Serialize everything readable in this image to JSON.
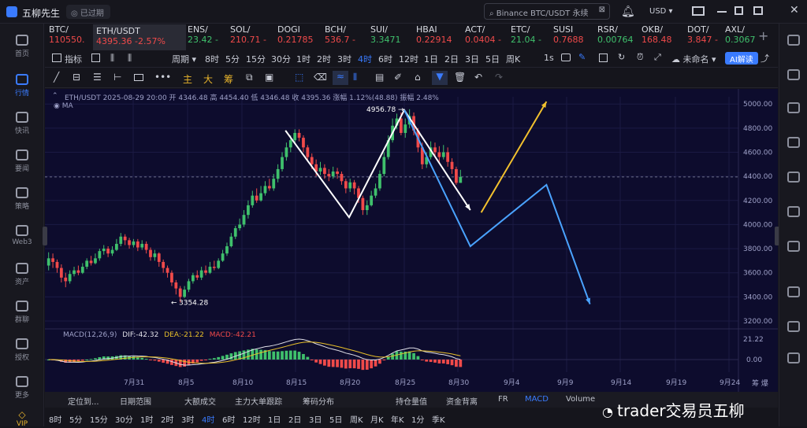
{
  "app": {
    "title": "五柳先生",
    "status": "已过期",
    "search_placeholder": "Binance BTC/USDT 永续",
    "currency": "USD"
  },
  "tickers": [
    {
      "name": "BTC/",
      "price": "110550.",
      "dir": "dn"
    },
    {
      "name": "ETH/USDT",
      "price": "4395.36 -2.57%",
      "dir": "dn"
    },
    {
      "name": "ENS/",
      "price": "23.42 -",
      "dir": "up"
    },
    {
      "name": "SOL/",
      "price": "210.71 -",
      "dir": "dn"
    },
    {
      "name": "DOGI",
      "price": "0.21785",
      "dir": "dn"
    },
    {
      "name": "BCH/",
      "price": "536.7 -",
      "dir": "dn"
    },
    {
      "name": "SUI/",
      "price": "3.3471",
      "dir": "up"
    },
    {
      "name": "HBAI",
      "price": "0.22914",
      "dir": "dn"
    },
    {
      "name": "ACT/",
      "price": "0.0404 -",
      "dir": "dn"
    },
    {
      "name": "ETC/",
      "price": "21.04 -",
      "dir": "up"
    },
    {
      "name": "SUSI",
      "price": "0.7688",
      "dir": "dn"
    },
    {
      "name": "RSR/",
      "price": "0.00764",
      "dir": "up"
    },
    {
      "name": "OKB/",
      "price": "168.48",
      "dir": "dn"
    },
    {
      "name": "DOT/",
      "price": "3.847 -",
      "dir": "dn"
    },
    {
      "name": "AXL/",
      "price": "0.3067",
      "dir": "up"
    }
  ],
  "nav": [
    "首页",
    "行情",
    "快讯",
    "要闻",
    "策略",
    "Web3",
    "资产",
    "群聊",
    "授权",
    "更多",
    "VIP"
  ],
  "toolbar": {
    "indicators": "指标",
    "period": "周期",
    "intervals": [
      "8时",
      "5分",
      "15分",
      "30分",
      "1时",
      "2时",
      "3时",
      "4时",
      "6时",
      "12时",
      "1日",
      "2日",
      "3日",
      "5日",
      "周K"
    ],
    "selected_interval": "4时",
    "right_interval": "1s",
    "layout_name": "未命名",
    "ai": "AI解读"
  },
  "drawing": {
    "main": "主",
    "big": "大",
    "chip": "筹"
  },
  "chart": {
    "legend": "ETH/USDT  2025-08-29 20:00  开 4346.48  高 4454.40  低 4346.48  收 4395.36  涨幅 1.12%(48.88)  振幅 2.48%",
    "ma_label": "MA",
    "macd_label": "MACD(12,26,9)",
    "dif": "DIF:-42.32",
    "dea": "DEA:-21.22",
    "macd": "MACD:-42.21",
    "high_label": "4956.78",
    "low_label": "3354.28",
    "y_ticks": [
      "5000.00",
      "4800.00",
      "4600.00",
      "4400.00",
      "4200.00",
      "4000.00",
      "3800.00",
      "3600.00",
      "3400.00",
      "3200.00"
    ],
    "macd_ticks": [
      "21.22",
      "0.00"
    ],
    "x_ticks": [
      "7月31",
      "8月5",
      "8月10",
      "8月15",
      "8月20",
      "8月25",
      "8月30",
      "9月4",
      "9月9",
      "9月14",
      "9月19",
      "9月24"
    ],
    "corner": "筹 爆"
  },
  "chart_data": {
    "type": "candlestick",
    "symbol": "ETH/USDT",
    "interval": "4h",
    "ylim": [
      3200,
      5060
    ],
    "grid": true,
    "candles": [
      [
        3660,
        3720,
        3770,
        3620
      ],
      [
        3720,
        3690,
        3760,
        3640
      ],
      [
        3690,
        3640,
        3710,
        3600
      ],
      [
        3640,
        3560,
        3670,
        3520
      ],
      [
        3560,
        3530,
        3600,
        3480
      ],
      [
        3530,
        3590,
        3620,
        3510
      ],
      [
        3590,
        3620,
        3650,
        3570
      ],
      [
        3620,
        3600,
        3660,
        3580
      ],
      [
        3600,
        3650,
        3680,
        3590
      ],
      [
        3650,
        3700,
        3720,
        3630
      ],
      [
        3700,
        3680,
        3740,
        3660
      ],
      [
        3680,
        3720,
        3760,
        3670
      ],
      [
        3720,
        3780,
        3800,
        3700
      ],
      [
        3780,
        3800,
        3830,
        3750
      ],
      [
        3800,
        3760,
        3820,
        3730
      ],
      [
        3760,
        3790,
        3820,
        3740
      ],
      [
        3790,
        3840,
        3880,
        3780
      ],
      [
        3840,
        3900,
        3930,
        3820
      ],
      [
        3900,
        3870,
        3920,
        3830
      ],
      [
        3870,
        3830,
        3890,
        3800
      ],
      [
        3830,
        3860,
        3880,
        3810
      ],
      [
        3860,
        3810,
        3880,
        3780
      ],
      [
        3810,
        3840,
        3870,
        3790
      ],
      [
        3840,
        3790,
        3860,
        3760
      ],
      [
        3790,
        3730,
        3810,
        3700
      ],
      [
        3730,
        3760,
        3790,
        3700
      ],
      [
        3760,
        3690,
        3770,
        3650
      ],
      [
        3690,
        3640,
        3710,
        3600
      ],
      [
        3640,
        3600,
        3660,
        3560
      ],
      [
        3600,
        3520,
        3620,
        3490
      ],
      [
        3520,
        3470,
        3540,
        3420
      ],
      [
        3470,
        3400,
        3490,
        3354
      ],
      [
        3400,
        3460,
        3490,
        3390
      ],
      [
        3460,
        3530,
        3550,
        3440
      ],
      [
        3530,
        3580,
        3600,
        3510
      ],
      [
        3580,
        3560,
        3620,
        3540
      ],
      [
        3560,
        3620,
        3650,
        3540
      ],
      [
        3620,
        3600,
        3660,
        3580
      ],
      [
        3600,
        3650,
        3690,
        3590
      ],
      [
        3650,
        3640,
        3700,
        3620
      ],
      [
        3640,
        3700,
        3720,
        3630
      ],
      [
        3700,
        3760,
        3790,
        3690
      ],
      [
        3760,
        3820,
        3850,
        3740
      ],
      [
        3820,
        3900,
        3930,
        3810
      ],
      [
        3900,
        3970,
        3990,
        3880
      ],
      [
        3970,
        4000,
        4050,
        3950
      ],
      [
        4000,
        4080,
        4120,
        3980
      ],
      [
        4080,
        4160,
        4200,
        4050
      ],
      [
        4160,
        4240,
        4280,
        4140
      ],
      [
        4240,
        4200,
        4300,
        4180
      ],
      [
        4200,
        4260,
        4320,
        4190
      ],
      [
        4260,
        4320,
        4360,
        4240
      ],
      [
        4320,
        4300,
        4380,
        4280
      ],
      [
        4300,
        4380,
        4420,
        4280
      ],
      [
        4380,
        4460,
        4500,
        4350
      ],
      [
        4460,
        4560,
        4600,
        4440
      ],
      [
        4560,
        4640,
        4680,
        4530
      ],
      [
        4640,
        4700,
        4740,
        4600
      ],
      [
        4700,
        4760,
        4790,
        4680
      ],
      [
        4760,
        4720,
        4790,
        4690
      ],
      [
        4720,
        4640,
        4740,
        4600
      ],
      [
        4640,
        4560,
        4660,
        4520
      ],
      [
        4560,
        4500,
        4590,
        4460
      ],
      [
        4500,
        4440,
        4540,
        4400
      ],
      [
        4440,
        4470,
        4520,
        4410
      ],
      [
        4470,
        4420,
        4500,
        4380
      ],
      [
        4420,
        4400,
        4460,
        4360
      ],
      [
        4400,
        4440,
        4480,
        4380
      ],
      [
        4440,
        4420,
        4470,
        4380
      ],
      [
        4420,
        4360,
        4440,
        4330
      ],
      [
        4360,
        4300,
        4380,
        4260
      ],
      [
        4300,
        4350,
        4380,
        4270
      ],
      [
        4350,
        4300,
        4370,
        4250
      ],
      [
        4300,
        4220,
        4320,
        4180
      ],
      [
        4220,
        4120,
        4240,
        4080
      ],
      [
        4120,
        4160,
        4200,
        4080
      ],
      [
        4160,
        4240,
        4280,
        4150
      ],
      [
        4240,
        4300,
        4340,
        4220
      ],
      [
        4300,
        4420,
        4450,
        4280
      ],
      [
        4420,
        4560,
        4600,
        4400
      ],
      [
        4560,
        4700,
        4740,
        4540
      ],
      [
        4700,
        4820,
        4880,
        4680
      ],
      [
        4820,
        4880,
        4920,
        4790
      ],
      [
        4880,
        4760,
        4930,
        4740
      ],
      [
        4760,
        4830,
        4880,
        4720
      ],
      [
        4830,
        4900,
        4956.78,
        4800
      ],
      [
        4900,
        4780,
        4930,
        4740
      ],
      [
        4780,
        4640,
        4800,
        4600
      ],
      [
        4640,
        4500,
        4680,
        4460
      ],
      [
        4500,
        4560,
        4600,
        4470
      ],
      [
        4560,
        4640,
        4690,
        4540
      ],
      [
        4640,
        4600,
        4680,
        4560
      ],
      [
        4600,
        4560,
        4650,
        4520
      ],
      [
        4560,
        4600,
        4660,
        4540
      ],
      [
        4600,
        4520,
        4640,
        4480
      ],
      [
        4520,
        4460,
        4550,
        4420
      ],
      [
        4460,
        4346,
        4480,
        4330
      ],
      [
        4346,
        4395,
        4454,
        4346
      ]
    ],
    "annotations": {
      "high": 4956.78,
      "low": 3354.28
    },
    "projection_paths": [
      {
        "color": "#ffffff",
        "points": [
          [
            "8月14",
            4780
          ],
          [
            "8月20",
            4060
          ],
          [
            "8月25",
            4950
          ],
          [
            "8月31",
            4120
          ]
        ]
      },
      {
        "color": "#f2c12e",
        "points": [
          [
            "9月1",
            4100
          ],
          [
            "9月7",
            5020
          ]
        ]
      },
      {
        "color": "#4aa3ff",
        "points": [
          [
            "8月25",
            4950
          ],
          [
            "8月31",
            3820
          ],
          [
            "9月7",
            4330
          ],
          [
            "9月11",
            3340
          ]
        ]
      }
    ],
    "macd": {
      "dif": -42.32,
      "dea": -21.22,
      "hist": -42.21
    }
  },
  "bottom_tabs": [
    "定位到...",
    "日期范围",
    "大额成交",
    "主力大单跟踪",
    "筹码分布",
    "持仓量值",
    "资金背离",
    "FR",
    "MACD",
    "Volume"
  ],
  "bottom_intervals": [
    "8时",
    "5分",
    "15分",
    "30分",
    "1时",
    "2时",
    "3时",
    "4时",
    "6时",
    "12时",
    "1日",
    "2日",
    "3日",
    "5日",
    "周K",
    "月K",
    "年K",
    "1分",
    "季K"
  ],
  "watermark": "trader交易员五柳"
}
